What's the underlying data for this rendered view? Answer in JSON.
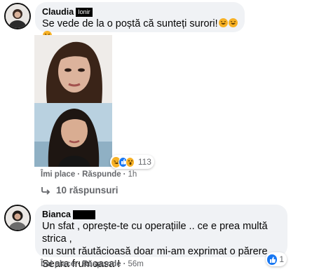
{
  "comments": [
    {
      "author": "Claudia",
      "author_redacted_tag": "Ionir",
      "text": "Se vede de la o poștă că sunteți surori!",
      "emoji_count": 3,
      "actions": {
        "like": "Îmi place",
        "reply": "Răspunde",
        "time": "1h"
      },
      "reactions": {
        "icons": [
          "haha-icon",
          "like-icon",
          "wow-icon"
        ],
        "count": "113"
      },
      "replies_label": "10 răspunsuri"
    },
    {
      "author": "Bianca",
      "text_lines": [
        "Un sfat , oprește-te cu operațiile .. ce e prea multă strica ,",
        "nu sunt răutăcioasă doar mi-am exprimat o părere .",
        "Seara frumoasa !"
      ],
      "actions": {
        "like": "Îmi place",
        "reply": "Răspunde",
        "time": "56m"
      },
      "reactions": {
        "icons": [
          "like-icon"
        ],
        "count": "1"
      }
    }
  ],
  "colors": {
    "bubble": "#f0f2f5",
    "secondary_text": "#65676b",
    "like_blue": "#1877f2",
    "emoji_yellow": "#f7b125"
  }
}
